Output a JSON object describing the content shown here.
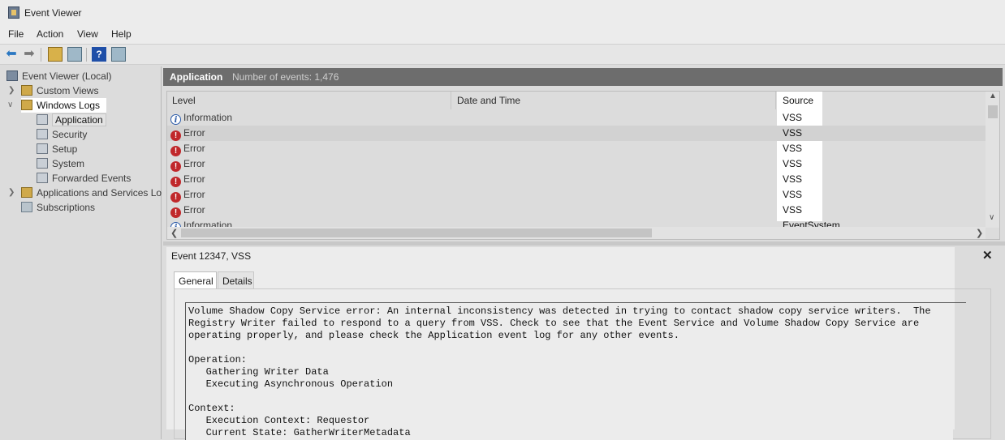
{
  "window": {
    "title": "Event Viewer"
  },
  "menu": [
    "File",
    "Action",
    "View",
    "Help"
  ],
  "toolbar": {
    "icons": [
      "back-arrow-icon",
      "forward-arrow-icon",
      "open-folder-icon",
      "properties-icon",
      "help-icon",
      "show-hide-pane-icon"
    ]
  },
  "tree": {
    "root": "Event Viewer (Local)",
    "custom_views": "Custom Views",
    "windows_logs": "Windows Logs",
    "logs": [
      "Application",
      "Security",
      "Setup",
      "System",
      "Forwarded Events"
    ],
    "apps_services": "Applications and Services Lo",
    "subscriptions": "Subscriptions"
  },
  "pane_header": {
    "title": "Application",
    "count": "Number of events: 1,476"
  },
  "event_table": {
    "columns": {
      "level": "Level",
      "date": "Date and Time",
      "source": "Source"
    },
    "rows": [
      {
        "level": "Information",
        "source": "VSS"
      },
      {
        "level": "Error",
        "source": "VSS"
      },
      {
        "level": "Error",
        "source": "VSS"
      },
      {
        "level": "Error",
        "source": "VSS"
      },
      {
        "level": "Error",
        "source": "VSS"
      },
      {
        "level": "Error",
        "source": "VSS"
      },
      {
        "level": "Error",
        "source": "VSS"
      },
      {
        "level": "Information",
        "source": "EventSystem"
      }
    ],
    "selected_row": 1
  },
  "detail": {
    "title": "Event 12347, VSS",
    "close_label": "✕",
    "tabs": {
      "general": "General",
      "details": "Details"
    },
    "message": "Volume Shadow Copy Service error: An internal inconsistency was detected in trying to contact shadow copy service writers.  The Registry Writer failed to respond to a query from VSS. Check to see that the Event Service and Volume Shadow Copy Service are operating properly, and please check the Application event log for any other events.\n\nOperation:\n   Gathering Writer Data\n   Executing Asynchronous Operation\n\nContext:\n   Execution Context: Requestor\n   Current State: GatherWriterMetadata"
  },
  "colors": {
    "header_bg": "#6d6d6d",
    "error": "#c0282b",
    "info": "#2a5aa8"
  }
}
